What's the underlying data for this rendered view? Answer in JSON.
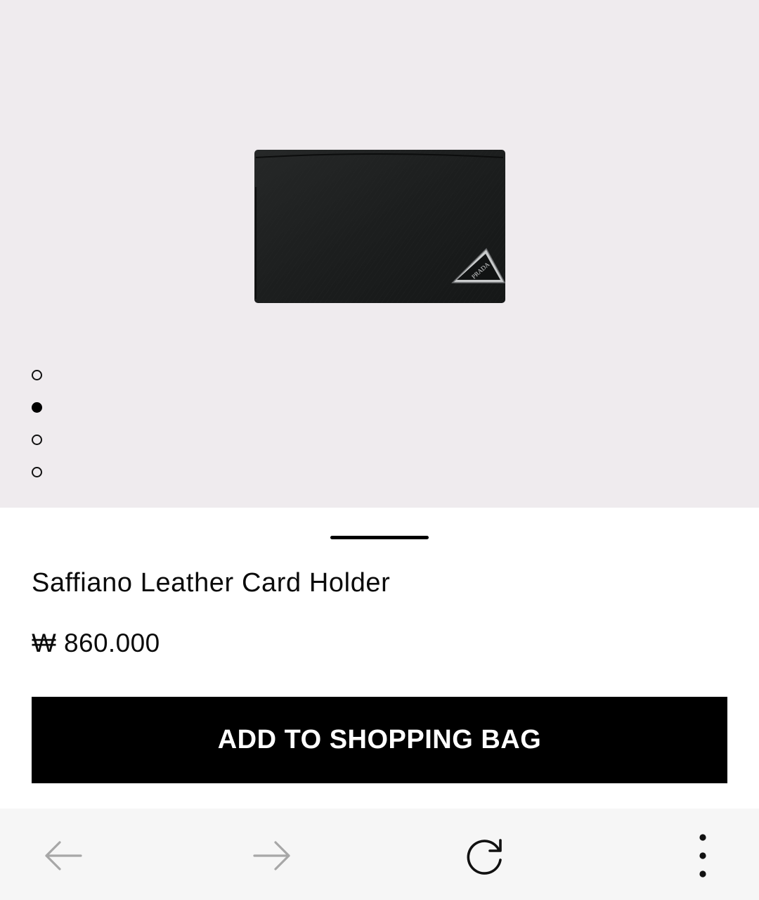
{
  "product": {
    "title": "Saffiano Leather Card Holder",
    "price": "₩ 860.000",
    "logo_text": "PRADA"
  },
  "gallery": {
    "image_count": 4,
    "active_index": 1
  },
  "actions": {
    "add_to_bag_label": "ADD TO SHOPPING BAG"
  },
  "browser_toolbar": {
    "icons": [
      "back-arrow-icon",
      "forward-arrow-icon",
      "reload-icon",
      "more-vertical-icon"
    ],
    "back_enabled": false,
    "forward_enabled": false
  },
  "colors": {
    "gallery_background": "#efebee",
    "button_background": "#000000",
    "button_text": "#ffffff",
    "toolbar_background": "#f6f6f6"
  }
}
